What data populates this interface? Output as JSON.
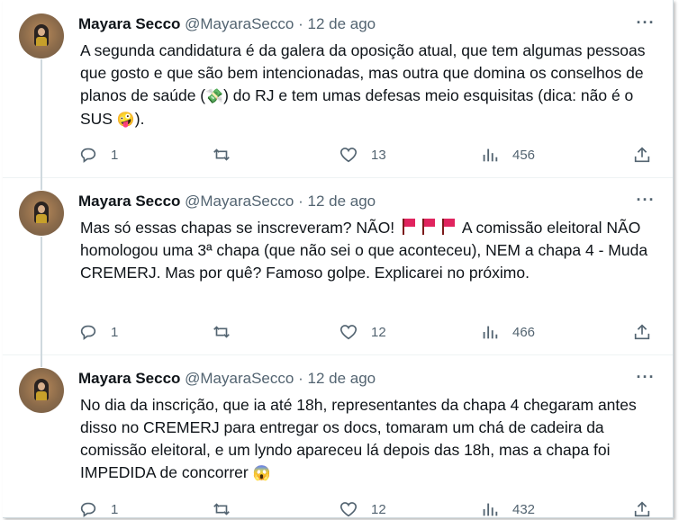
{
  "tweets": [
    {
      "name": "Mayara Secco",
      "handle": "@MayaraSecco",
      "sep": "·",
      "time": "12 de ago",
      "text_parts": [
        "A segunda candidatura é da galera da oposição atual, que tem algumas pessoas que gosto e que são bem intencionadas, mas outra que domina os conselhos de planos de saúde (",
        "💸",
        ") do RJ e tem umas defesas meio esquisitas (dica: não é o SUS ",
        "🤪",
        ")."
      ],
      "replies": "1",
      "retweets": "",
      "likes": "13",
      "views": "456"
    },
    {
      "name": "Mayara Secco",
      "handle": "@MayaraSecco",
      "sep": "·",
      "time": "12 de ago",
      "text_parts": [
        "Mas só essas chapas se inscreveram? NÃO! ",
        " A comissão eleitoral NÃO homologou uma 3ª chapa (que não sei o que aconteceu), NEM a chapa 4 - Muda CREMERJ. Mas por quê? Famoso golpe. Explicarei no próximo."
      ],
      "flag_icon": "red-flag-icon",
      "replies": "1",
      "retweets": "",
      "likes": "12",
      "views": "466"
    },
    {
      "name": "Mayara Secco",
      "handle": "@MayaraSecco",
      "sep": "·",
      "time": "12 de ago",
      "text_parts": [
        "No dia da inscrição, que ia até 18h, representantes da chapa 4 chegaram antes disso no CREMERJ para entregar os docs, tomaram um chá de cadeira da comissão eleitoral, e um lyndo apareceu lá depois das 18h, mas a chapa foi IMPEDIDA de concorrer ",
        "😱"
      ],
      "replies": "1",
      "retweets": "",
      "likes": "12",
      "views": "432"
    }
  ],
  "colors": {
    "text": "#0f1419",
    "muted": "#536471",
    "border": "#eff3f4",
    "flag": "#e0245e"
  }
}
